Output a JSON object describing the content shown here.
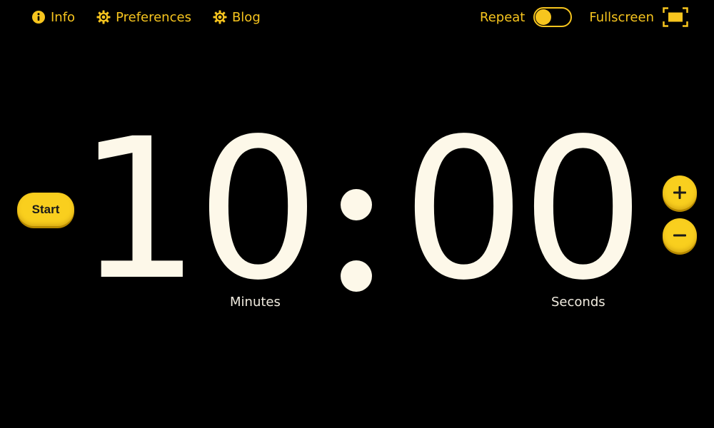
{
  "nav": {
    "items": [
      {
        "label": "Info",
        "icon": "info-icon"
      },
      {
        "label": "Preferences",
        "icon": "gear-icon"
      },
      {
        "label": "Blog",
        "icon": "gear-icon"
      }
    ]
  },
  "controls": {
    "repeat_label": "Repeat",
    "repeat_on": false,
    "fullscreen_label": "Fullscreen",
    "fullscreen_icon": "fullscreen-icon"
  },
  "timer": {
    "start_label": "Start",
    "minutes": "10",
    "seconds": "00",
    "minutes_label": "Minutes",
    "seconds_label": "Seconds",
    "increment_icon": "plus-icon",
    "decrement_icon": "minus-icon"
  },
  "colors": {
    "background": "#000000",
    "accent": "#f9cf1e",
    "digits": "#fdf8e9"
  }
}
